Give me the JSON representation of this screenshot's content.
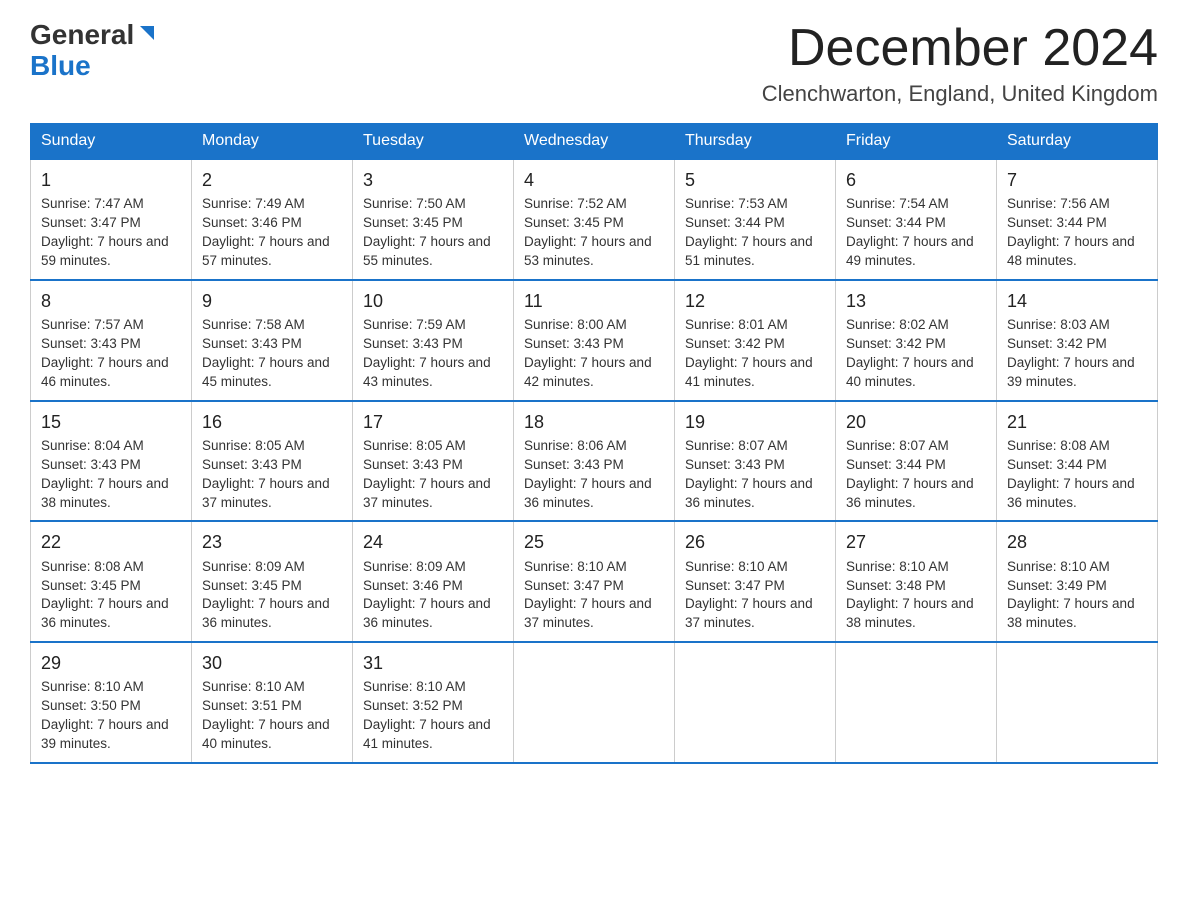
{
  "logo": {
    "general": "General",
    "blue": "Blue"
  },
  "title": "December 2024",
  "subtitle": "Clenchwarton, England, United Kingdom",
  "days_of_week": [
    "Sunday",
    "Monday",
    "Tuesday",
    "Wednesday",
    "Thursday",
    "Friday",
    "Saturday"
  ],
  "weeks": [
    [
      {
        "day": "1",
        "sunrise": "7:47 AM",
        "sunset": "3:47 PM",
        "daylight": "7 hours and 59 minutes."
      },
      {
        "day": "2",
        "sunrise": "7:49 AM",
        "sunset": "3:46 PM",
        "daylight": "7 hours and 57 minutes."
      },
      {
        "day": "3",
        "sunrise": "7:50 AM",
        "sunset": "3:45 PM",
        "daylight": "7 hours and 55 minutes."
      },
      {
        "day": "4",
        "sunrise": "7:52 AM",
        "sunset": "3:45 PM",
        "daylight": "7 hours and 53 minutes."
      },
      {
        "day": "5",
        "sunrise": "7:53 AM",
        "sunset": "3:44 PM",
        "daylight": "7 hours and 51 minutes."
      },
      {
        "day": "6",
        "sunrise": "7:54 AM",
        "sunset": "3:44 PM",
        "daylight": "7 hours and 49 minutes."
      },
      {
        "day": "7",
        "sunrise": "7:56 AM",
        "sunset": "3:44 PM",
        "daylight": "7 hours and 48 minutes."
      }
    ],
    [
      {
        "day": "8",
        "sunrise": "7:57 AM",
        "sunset": "3:43 PM",
        "daylight": "7 hours and 46 minutes."
      },
      {
        "day": "9",
        "sunrise": "7:58 AM",
        "sunset": "3:43 PM",
        "daylight": "7 hours and 45 minutes."
      },
      {
        "day": "10",
        "sunrise": "7:59 AM",
        "sunset": "3:43 PM",
        "daylight": "7 hours and 43 minutes."
      },
      {
        "day": "11",
        "sunrise": "8:00 AM",
        "sunset": "3:43 PM",
        "daylight": "7 hours and 42 minutes."
      },
      {
        "day": "12",
        "sunrise": "8:01 AM",
        "sunset": "3:42 PM",
        "daylight": "7 hours and 41 minutes."
      },
      {
        "day": "13",
        "sunrise": "8:02 AM",
        "sunset": "3:42 PM",
        "daylight": "7 hours and 40 minutes."
      },
      {
        "day": "14",
        "sunrise": "8:03 AM",
        "sunset": "3:42 PM",
        "daylight": "7 hours and 39 minutes."
      }
    ],
    [
      {
        "day": "15",
        "sunrise": "8:04 AM",
        "sunset": "3:43 PM",
        "daylight": "7 hours and 38 minutes."
      },
      {
        "day": "16",
        "sunrise": "8:05 AM",
        "sunset": "3:43 PM",
        "daylight": "7 hours and 37 minutes."
      },
      {
        "day": "17",
        "sunrise": "8:05 AM",
        "sunset": "3:43 PM",
        "daylight": "7 hours and 37 minutes."
      },
      {
        "day": "18",
        "sunrise": "8:06 AM",
        "sunset": "3:43 PM",
        "daylight": "7 hours and 36 minutes."
      },
      {
        "day": "19",
        "sunrise": "8:07 AM",
        "sunset": "3:43 PM",
        "daylight": "7 hours and 36 minutes."
      },
      {
        "day": "20",
        "sunrise": "8:07 AM",
        "sunset": "3:44 PM",
        "daylight": "7 hours and 36 minutes."
      },
      {
        "day": "21",
        "sunrise": "8:08 AM",
        "sunset": "3:44 PM",
        "daylight": "7 hours and 36 minutes."
      }
    ],
    [
      {
        "day": "22",
        "sunrise": "8:08 AM",
        "sunset": "3:45 PM",
        "daylight": "7 hours and 36 minutes."
      },
      {
        "day": "23",
        "sunrise": "8:09 AM",
        "sunset": "3:45 PM",
        "daylight": "7 hours and 36 minutes."
      },
      {
        "day": "24",
        "sunrise": "8:09 AM",
        "sunset": "3:46 PM",
        "daylight": "7 hours and 36 minutes."
      },
      {
        "day": "25",
        "sunrise": "8:10 AM",
        "sunset": "3:47 PM",
        "daylight": "7 hours and 37 minutes."
      },
      {
        "day": "26",
        "sunrise": "8:10 AM",
        "sunset": "3:47 PM",
        "daylight": "7 hours and 37 minutes."
      },
      {
        "day": "27",
        "sunrise": "8:10 AM",
        "sunset": "3:48 PM",
        "daylight": "7 hours and 38 minutes."
      },
      {
        "day": "28",
        "sunrise": "8:10 AM",
        "sunset": "3:49 PM",
        "daylight": "7 hours and 38 minutes."
      }
    ],
    [
      {
        "day": "29",
        "sunrise": "8:10 AM",
        "sunset": "3:50 PM",
        "daylight": "7 hours and 39 minutes."
      },
      {
        "day": "30",
        "sunrise": "8:10 AM",
        "sunset": "3:51 PM",
        "daylight": "7 hours and 40 minutes."
      },
      {
        "day": "31",
        "sunrise": "8:10 AM",
        "sunset": "3:52 PM",
        "daylight": "7 hours and 41 minutes."
      },
      null,
      null,
      null,
      null
    ]
  ]
}
